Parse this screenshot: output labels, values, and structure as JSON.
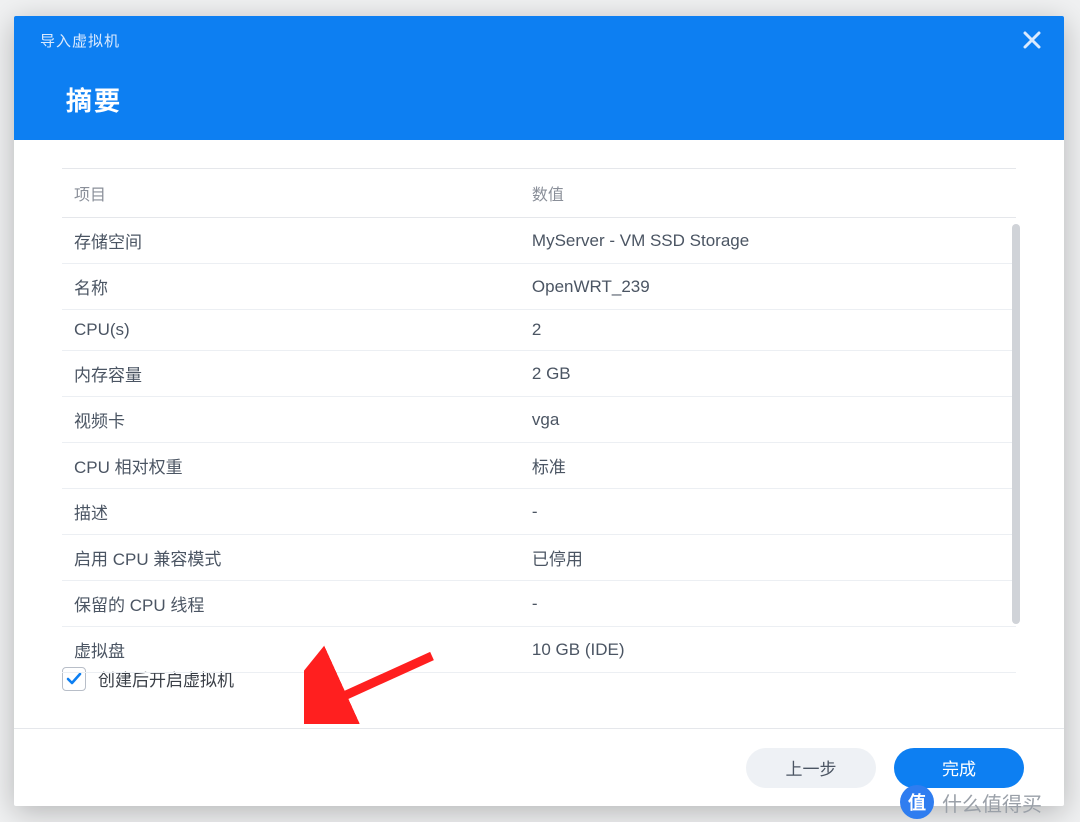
{
  "dialog": {
    "subtitle": "导入虚拟机",
    "title": "摘要"
  },
  "table": {
    "headers": {
      "item": "项目",
      "value": "数值"
    },
    "rows": [
      {
        "label": "存储空间",
        "value": "MyServer - VM SSD Storage"
      },
      {
        "label": "名称",
        "value": "OpenWRT_239"
      },
      {
        "label": "CPU(s)",
        "value": "2"
      },
      {
        "label": "内存容量",
        "value": "2 GB"
      },
      {
        "label": "视频卡",
        "value": "vga"
      },
      {
        "label": "CPU 相对权重",
        "value": "标准"
      },
      {
        "label": "描述",
        "value": "-"
      },
      {
        "label": "启用 CPU 兼容模式",
        "value": "已停用"
      },
      {
        "label": "保留的 CPU 线程",
        "value": "-"
      },
      {
        "label": "虚拟盘",
        "value": "10 GB (IDE)"
      }
    ]
  },
  "checkbox": {
    "checked": true,
    "label": "创建后开启虚拟机"
  },
  "footer": {
    "back": "上一步",
    "done": "完成"
  },
  "watermark": {
    "badge": "值",
    "text": "什么值得买"
  },
  "colors": {
    "primary": "#0d7ff2",
    "arrow": "#ff1f1f"
  }
}
